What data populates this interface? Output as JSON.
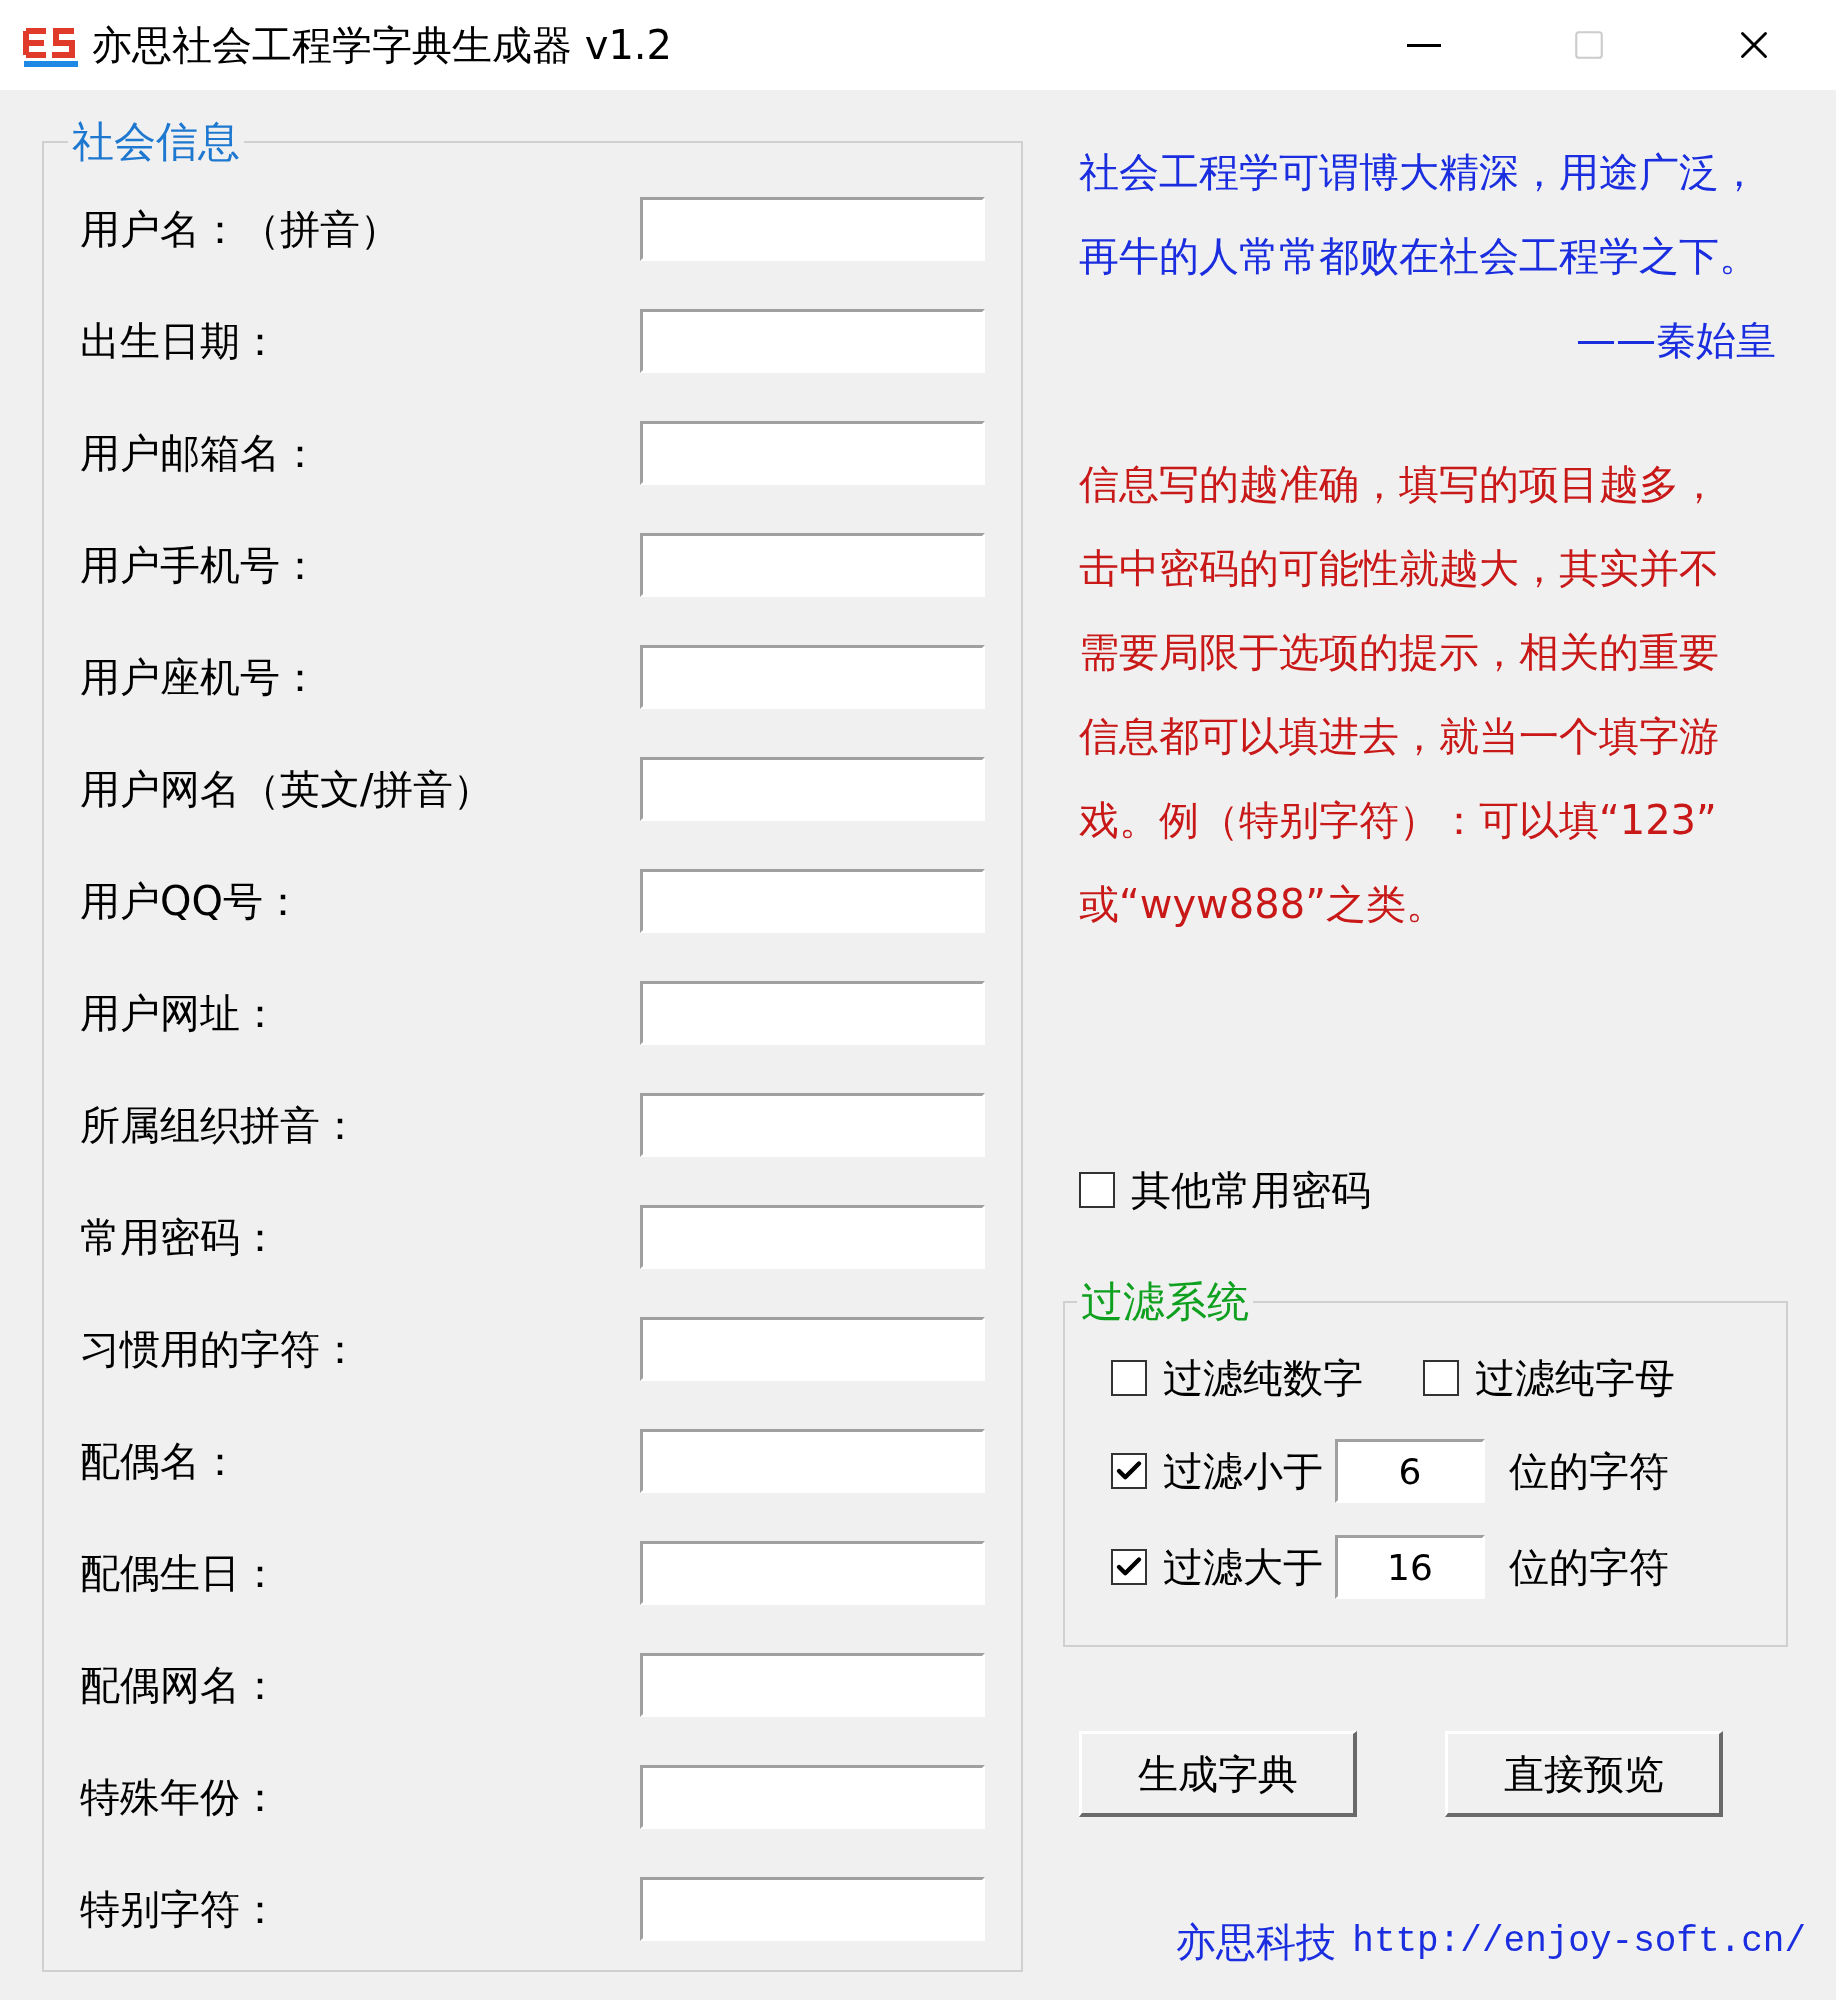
{
  "window": {
    "title": "亦思社会工程学字典生成器 v1.2"
  },
  "social_info": {
    "title": "社会信息",
    "fields": [
      {
        "label": "用户名：（拼音）"
      },
      {
        "label": "出生日期："
      },
      {
        "label": "用户邮箱名："
      },
      {
        "label": "用户手机号："
      },
      {
        "label": "用户座机号："
      },
      {
        "label": "用户网名（英文/拼音）"
      },
      {
        "label": "用户QQ号："
      },
      {
        "label": "用户网址："
      },
      {
        "label": "所属组织拼音："
      },
      {
        "label": "常用密码："
      },
      {
        "label": "习惯用的字符："
      },
      {
        "label": "配偶名："
      },
      {
        "label": "配偶生日："
      },
      {
        "label": "配偶网名："
      },
      {
        "label": "特殊年份："
      },
      {
        "label": "特别字符："
      }
    ]
  },
  "quote": {
    "lines": [
      "社会工程学可谓博大精深，用途广泛，",
      "再牛的人常常都败在社会工程学之下。"
    ],
    "attribution": "——秦始皇"
  },
  "tips": {
    "lines": [
      "信息写的越准确，填写的项目越多，",
      "击中密码的可能性就越大，其实并不",
      "需要局限于选项的提示，相关的重要",
      "信息都可以填进去，就当一个填字游",
      "戏。例（特别字符）：可以填“123”",
      "或“wyw888”之类。"
    ]
  },
  "other_passwords": {
    "label": "其他常用密码",
    "checked": false
  },
  "filter": {
    "title": "过滤系统",
    "options": [
      {
        "label": "过滤纯数字",
        "checked": false
      },
      {
        "label": "过滤纯字母",
        "checked": false
      }
    ],
    "rows": [
      {
        "label": "过滤小于",
        "checked": true,
        "value": "6",
        "suffix": "位的字符"
      },
      {
        "label": "过滤大于",
        "checked": true,
        "value": "16",
        "suffix": "位的字符"
      }
    ]
  },
  "buttons": [
    "生成字典",
    "直接预览"
  ],
  "footer": {
    "company": "亦思科技",
    "url": "http://enjoy-soft.cn/"
  }
}
